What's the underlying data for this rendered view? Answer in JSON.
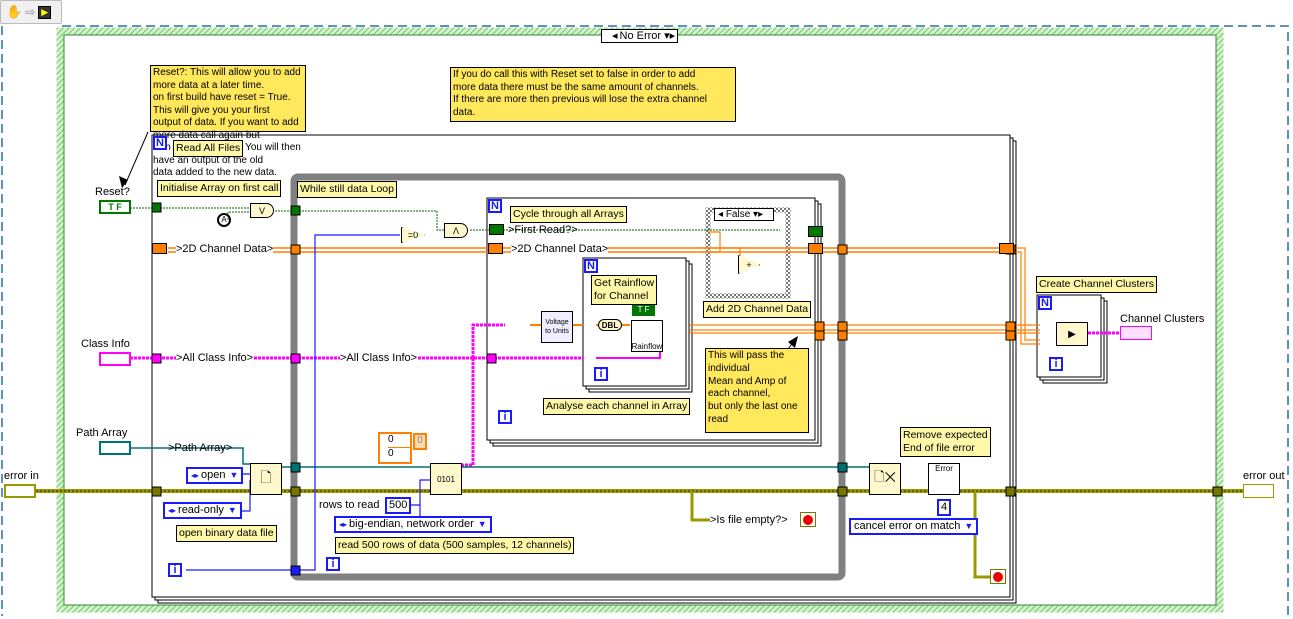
{
  "toolbar": {
    "hand_icon": "hand-tool-icon",
    "arrow_icon": "arrow-icon",
    "run_icon": "highlight-execution-icon"
  },
  "case_selector": {
    "value": "No Error"
  },
  "comments": {
    "reset": "Reset?: This will allow you to add more data at a later time.\non first build have reset = True. This will give you your first\noutput of data. If you want to add more data call again but\nwith it set to FALSE. You will then have an output of the old\ndata added to the new data.",
    "channels": "If you do call this with Reset set to false in order to add\nmore data there must be the same amount of channels.\nIf there are more then previous will lose the extra channel\ndata.",
    "pass": "This will pass the\nindividual\nMean and Amp of\neach channel,\nbut only the last one\nread"
  },
  "labels": {
    "read_all_files": "Read All Files",
    "init_array": "Initialise Array on first call",
    "while_loop": "While still data Loop",
    "cycle": "Cycle through all Arrays",
    "get_rainflow": "Get Rainflow\nfor Channel",
    "add_2d": "Add 2D Channel Data",
    "analyse": "Analyse each channel in Array",
    "create_clusters": "Create Channel Clusters",
    "remove_eof": "Remove expected\nEnd of file error",
    "open_binary": "open binary data file",
    "read_500": "read 500 rows of data (500 samples, 12 channels)"
  },
  "terminals": {
    "reset": "Reset?",
    "class_info": "Class Info",
    "path_array": "Path Array",
    "error_in": "error in",
    "error_out": "error out",
    "channel_clusters": "Channel Clusters",
    "rows_to_read": "rows to read"
  },
  "shift_registers": {
    "first_read": ">First Read?>",
    "channel_data_outer": ">2D Channel Data>",
    "channel_data_inner": ">2D Channel Data>",
    "all_class_info_outer": ">All Class Info>",
    "all_class_info_inner": ">All Class Info>",
    "path_array": ">Path Array>",
    "is_file_empty": ">Is file empty?>"
  },
  "constants": {
    "open_mode": "open",
    "access": "read-only",
    "rows": "500",
    "byte_order": "big-endian, network order",
    "error_code": "4",
    "cancel_mode": "cancel error on match",
    "inner_case": "False",
    "array_vals": [
      "0",
      "0"
    ],
    "array_index": "0",
    "bool_tf": "T F",
    "dbl": "DBL",
    "rainflow": "Rainflow",
    "vtu": "Voltage to Units",
    "error_node": "Error"
  },
  "colors": {
    "orange_wire": "#ff7f00",
    "pink_wire": "#ff00ff",
    "error_wire": "#999900",
    "bool_wire": "#006600",
    "int_wire": "#1a1aff",
    "path_wire": "#007070",
    "case_green": "#66cc66",
    "while_gray": "#808080"
  }
}
